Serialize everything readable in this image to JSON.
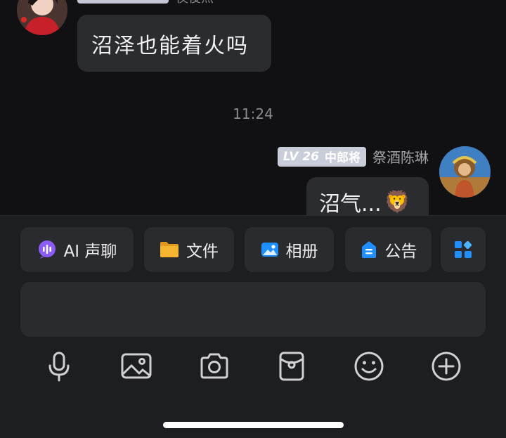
{
  "chat": {
    "top_sender_name": "侯俊杰",
    "left_message": "沼泽也能着火吗",
    "time_divider": "11:24",
    "right_sender": {
      "level": "LV 26",
      "rank": "中郎将",
      "name": "祭酒陈琳"
    },
    "right_message": "沼气...",
    "right_message_emoji": "🦁"
  },
  "panel": {
    "quick_actions": [
      {
        "label": "AI 声聊",
        "icon": "ai-voice-chat-icon"
      },
      {
        "label": "文件",
        "icon": "folder-icon"
      },
      {
        "label": "相册",
        "icon": "album-icon"
      },
      {
        "label": "公告",
        "icon": "announcement-icon"
      },
      {
        "label": "",
        "icon": "apps-grid-icon"
      }
    ],
    "input_placeholder": "",
    "toolbar": [
      "microphone-icon",
      "image-icon",
      "camera-icon",
      "red-packet-icon",
      "emoji-icon",
      "plus-icon"
    ]
  },
  "colors": {
    "background": "#111113",
    "bubble": "#2b2c30",
    "panel": "#1d1e21",
    "chip": "#2a2b2f",
    "level_badge": "#c9ccd9",
    "ai_purple": "#8b5cf6",
    "folder_yellow": "#f6b531",
    "blue_accent": "#1f8fff"
  }
}
